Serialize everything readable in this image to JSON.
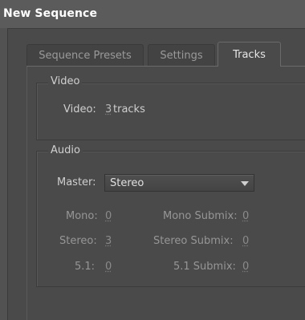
{
  "window": {
    "title": "New Sequence"
  },
  "tabs": [
    {
      "label": "Sequence Presets"
    },
    {
      "label": "Settings"
    },
    {
      "label": "Tracks"
    }
  ],
  "video": {
    "group_title": "Video",
    "label": "Video:",
    "count": "3",
    "unit": "tracks"
  },
  "audio": {
    "group_title": "Audio",
    "master_label": "Master:",
    "master_value": "Stereo",
    "rows": [
      {
        "label": "Mono:",
        "value": "0",
        "submix_label": "Mono Submix:",
        "submix_value": "0"
      },
      {
        "label": "Stereo:",
        "value": "3",
        "submix_label": "Stereo Submix:",
        "submix_value": "0"
      },
      {
        "label": "5.1:",
        "value": "0",
        "submix_label": "5.1 Submix:",
        "submix_value": "0"
      }
    ]
  },
  "icons": {
    "dropdown": "chevron-down-icon"
  }
}
